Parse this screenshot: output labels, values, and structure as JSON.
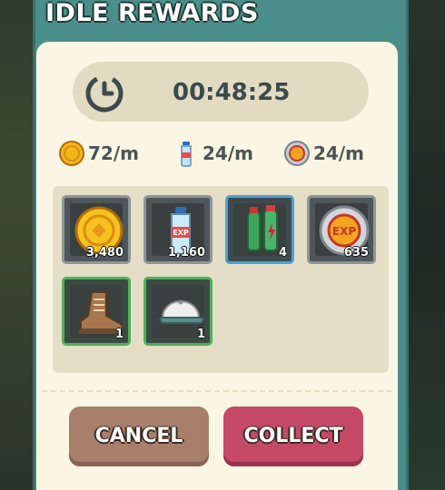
{
  "dialog": {
    "title": "IDLE REWARDS",
    "timer": "00:48:25"
  },
  "rates": [
    {
      "icon": "gold-coin-icon",
      "label": "72/m"
    },
    {
      "icon": "exp-bottle-icon",
      "label": "24/m"
    },
    {
      "icon": "exp-coin-icon",
      "label": "24/m"
    }
  ],
  "rewards": [
    {
      "icon": "gold-coin-icon",
      "count": "3,480",
      "rarity": "gray"
    },
    {
      "icon": "exp-bottle-icon",
      "count": "1,160",
      "rarity": "gray"
    },
    {
      "icon": "energy-drink-icon",
      "count": "4",
      "rarity": "blue"
    },
    {
      "icon": "exp-medal-icon",
      "count": "635",
      "rarity": "gray"
    },
    {
      "icon": "boot-icon",
      "count": "1",
      "rarity": "green"
    },
    {
      "icon": "cap-icon",
      "count": "1",
      "rarity": "green"
    }
  ],
  "buttons": {
    "cancel": "CANCEL",
    "collect": "COLLECT"
  },
  "colors": {
    "panel": "#4a8f8b",
    "card": "#fbf6e4",
    "cancel": "#a8806a",
    "collect": "#c44a67",
    "rarity_blue": "#4aa3d6",
    "rarity_green": "#4fb05a"
  }
}
